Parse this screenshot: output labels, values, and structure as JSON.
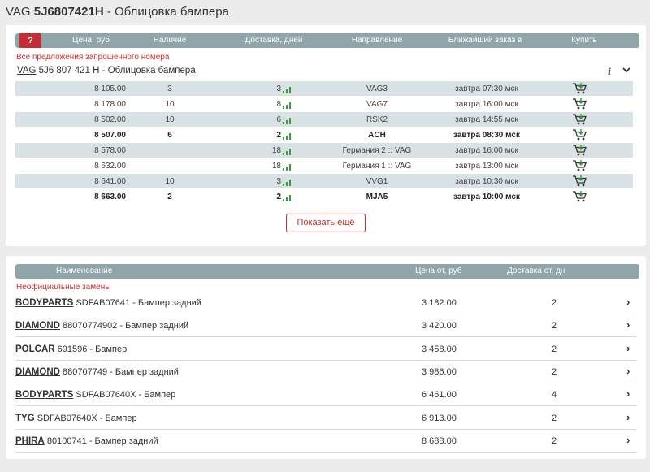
{
  "page": {
    "brand": "VAG",
    "number": "5J6807421H",
    "sep": " - ",
    "title": "Облицовка бампера"
  },
  "offers": {
    "help_label": "?",
    "headers": {
      "price": "Цена, руб",
      "stock": "Наличие",
      "delivery": "Доставка, дней",
      "direction": "Направление",
      "eta": "Ближайший заказ в",
      "buy": "Купить"
    },
    "section_label": "Все предложения запрошенного номера",
    "part": {
      "brand": "VAG",
      "number": "5J6 807 421 H",
      "sep": " - ",
      "name": "Облицовка бампера"
    },
    "info_icon": "i",
    "chevron_icon": "⌄",
    "rows": [
      {
        "price": "8 105.00",
        "stock": "3",
        "days": "3",
        "direction": "VAG3",
        "eta": "завтра 07:30 мск"
      },
      {
        "price": "8 178.00",
        "stock": "10",
        "days": "8",
        "direction": "VAG7",
        "eta": "завтра 16:00 мск"
      },
      {
        "price": "8 502.00",
        "stock": "10",
        "days": "6",
        "direction": "RSK2",
        "eta": "завтра 14:55 мск"
      },
      {
        "price": "8 507.00",
        "stock": "6",
        "days": "2",
        "direction": "ACH",
        "eta": "завтра 08:30 мск"
      },
      {
        "price": "8 578.00",
        "stock": "",
        "days": "18",
        "direction": "Германия 2 :: VAG",
        "eta": "завтра 16:00 мск"
      },
      {
        "price": "8 632.00",
        "stock": "",
        "days": "18",
        "direction": "Германия 1 :: VAG",
        "eta": "завтра 13:00 мск"
      },
      {
        "price": "8 641.00",
        "stock": "10",
        "days": "3",
        "direction": "VVG1",
        "eta": "завтра 10:30 мск"
      },
      {
        "price": "8 663.00",
        "stock": "2",
        "days": "2",
        "direction": "MJA5",
        "eta": "завтра 10:00 мск"
      }
    ],
    "more_label": "Показать ещё"
  },
  "replacements": {
    "headers": {
      "name": "Наименование",
      "price": "Цена от, руб",
      "delivery": "Доставка от, дн"
    },
    "section_label": "Неофициальные замены",
    "chevron_icon": "›",
    "rows": [
      {
        "brand": "BODYPARTS",
        "desc": " SDFAB07641 - Бампер задний",
        "price": "3 182.00",
        "days": "2"
      },
      {
        "brand": "DIAMOND",
        "desc": " 88070774902 - Бампер задний",
        "price": "3 420.00",
        "days": "2"
      },
      {
        "brand": "POLCAR",
        "desc": " 691596 - Бампер",
        "price": "3 458.00",
        "days": "2"
      },
      {
        "brand": "DIAMOND",
        "desc": " 880707749 - Бампер задний",
        "price": "3 986.00",
        "days": "2"
      },
      {
        "brand": "BODYPARTS",
        "desc": " SDFAB07640X - Бампер",
        "price": "6 461.00",
        "days": "4"
      },
      {
        "brand": "TYG",
        "desc": " SDFAB07640X - Бампер",
        "price": "6 913.00",
        "days": "2"
      },
      {
        "brand": "PHIRA",
        "desc": " 80100741 - Бампер задний",
        "price": "8 688.00",
        "days": "2"
      }
    ]
  },
  "colors": {
    "accent": "#c9302c",
    "header_bg": "#8fa5aa",
    "row_shade": "#d8e1e3",
    "signal": "#3a9b3a"
  }
}
